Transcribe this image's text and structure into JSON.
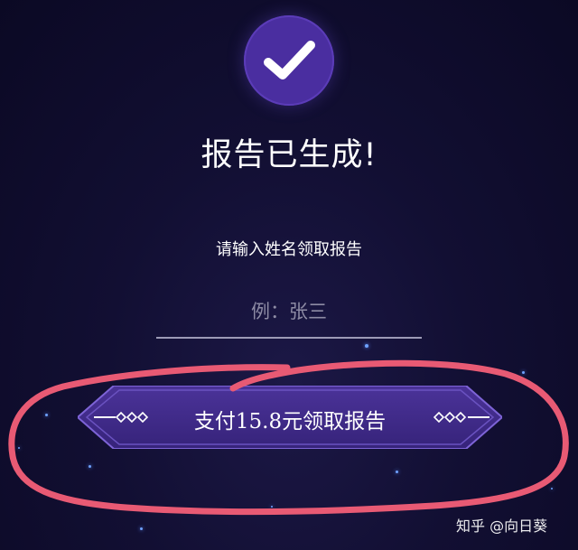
{
  "status": {
    "title": "报告已生成!"
  },
  "form": {
    "prompt": "请输入姓名领取报告",
    "name_placeholder": "例：张三",
    "name_value": ""
  },
  "pay_button": {
    "label": "支付15.8元领取报告"
  },
  "watermark": {
    "text": "知乎 @向日葵"
  },
  "colors": {
    "background": "#120f33",
    "badge": "#4a2ea0",
    "button": "#3f2a8c",
    "annotation_red": "#e85a74"
  },
  "icons": {
    "badge": "checkmark-icon"
  }
}
